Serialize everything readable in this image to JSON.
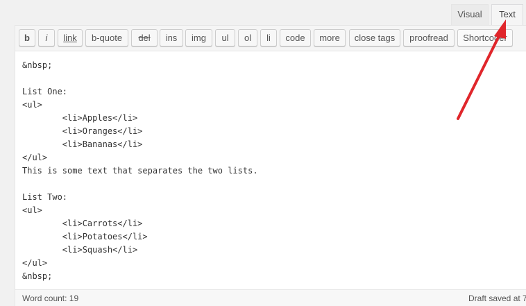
{
  "tabs": {
    "visual": "Visual",
    "text": "Text"
  },
  "toolbar": {
    "buttons": [
      "b",
      "i",
      "link",
      "b-quote",
      "del",
      "ins",
      "img",
      "ul",
      "ol",
      "li",
      "code",
      "more",
      "close tags",
      "proofread",
      "Shortcoder"
    ]
  },
  "editor": {
    "content": "&nbsp;\n\nList One:\n<ul>\n        <li>Apples</li>\n        <li>Oranges</li>\n        <li>Bananas</li>\n</ul>\nThis is some text that separates the two lists.\n\nList Two:\n<ul>\n        <li>Carrots</li>\n        <li>Potatoes</li>\n        <li>Squash</li>\n</ul>\n&nbsp;"
  },
  "status": {
    "word_count": "Word count: 19",
    "draft_saved": "Draft saved at 7"
  },
  "colors": {
    "annotation_arrow": "#e0262b"
  }
}
